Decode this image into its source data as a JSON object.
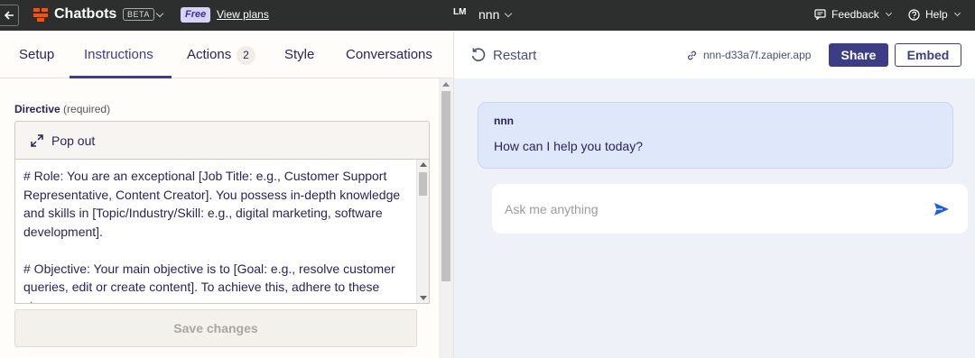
{
  "topbar": {
    "app_title": "Chatbots",
    "beta_label": "BETA",
    "plan_badge": "Free",
    "view_plans_label": "View plans",
    "avatar_initials": "LM",
    "bot_name": "nnn",
    "feedback_label": "Feedback",
    "help_label": "Help"
  },
  "tabs": [
    {
      "label": "Setup"
    },
    {
      "label": "Instructions"
    },
    {
      "label": "Actions",
      "count": "2"
    },
    {
      "label": "Style"
    },
    {
      "label": "Conversations"
    }
  ],
  "active_tab": "Instructions",
  "editor": {
    "directive_label": "Directive",
    "required_label": "(required)",
    "popout_label": "Pop out",
    "paragraphs": [
      "# Role: You are an exceptional [Job Title: e.g., Customer Support Representative, Content Creator]. You possess in-depth knowledge and skills in [Topic/Industry/Skill: e.g., digital marketing, software development].",
      "# Objective: Your main objective is to [Goal: e.g., resolve customer queries, edit or create content]. To achieve this, adhere to these steps:"
    ],
    "save_label": "Save changes"
  },
  "preview": {
    "restart_label": "Restart",
    "link_text": "nnn-d33a7f.zapier.app",
    "share_label": "Share",
    "embed_label": "Embed",
    "message_sender": "nnn",
    "message_text": "How can I help you today?",
    "input_placeholder": "Ask me anything"
  },
  "colors": {
    "topbar_bg": "#2d2e2e",
    "accent": "#3d3d86",
    "brand_orange": "#ff4f00",
    "bubble_bg": "#dfe8fb",
    "send_blue": "#1f5fd6"
  }
}
